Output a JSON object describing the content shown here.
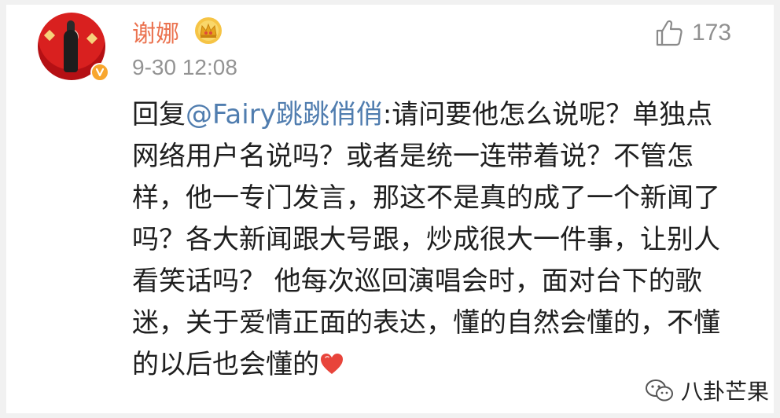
{
  "post": {
    "author": {
      "name": "谢娜",
      "avatar_icon": "avatar-photo",
      "badge_icon": "verified-v-icon",
      "rank_icon": "crown-icon"
    },
    "timestamp": "9-30 12:08",
    "likes": {
      "icon": "thumbs-up-icon",
      "count": "173"
    },
    "comment": {
      "prefix": "回复",
      "mention": "@Fairy跳跳俏俏",
      "body": ":请问要他怎么说呢？单独点网络用户名说吗？或者是统一连带着说？不管怎样，他一专门发言，那这不是真的成了一个新闻了吗？各大新闻跟大号跟，炒成很大一件事，让别人看笑话吗？ 他每次巡回演唱会时，面对台下的歌迷，关于爱情正面的表达，懂的自然会懂的，不懂的以后也会懂的",
      "emoji_icon": "heart-emoji"
    }
  },
  "watermark": {
    "icon": "wechat-icon",
    "text": "八卦芒果"
  },
  "colors": {
    "username": "#eb7350",
    "mention": "#507daf",
    "meta": "#939393",
    "text": "#1f1f1f"
  }
}
